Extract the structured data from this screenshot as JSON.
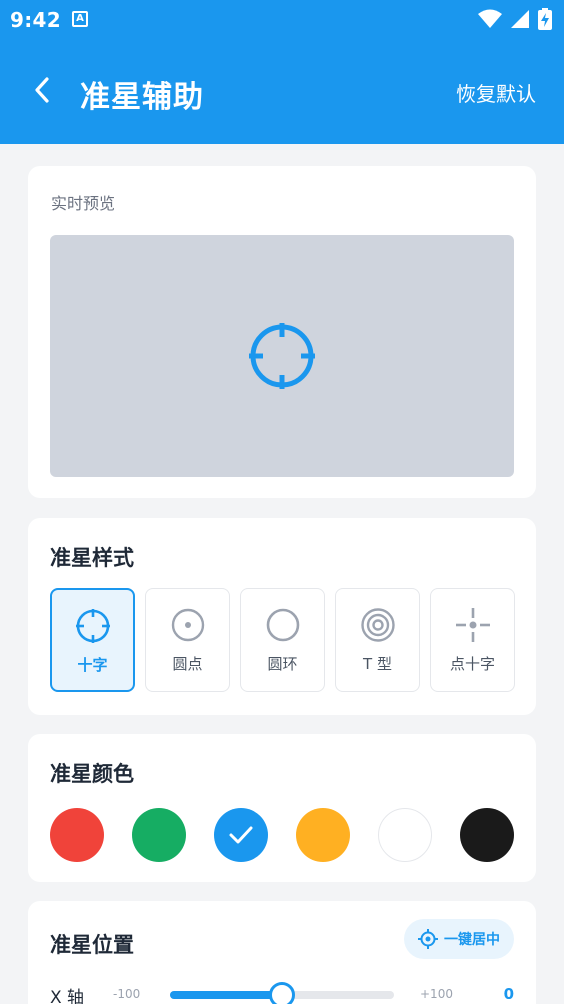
{
  "status": {
    "time": "9:42",
    "badge": "A"
  },
  "header": {
    "title": "准星辅助",
    "reset_label": "恢复默认"
  },
  "preview": {
    "label": "实时预览"
  },
  "style_section": {
    "title": "准星样式",
    "options": [
      {
        "label": "十字",
        "icon": "crosshair-icon",
        "selected": true
      },
      {
        "label": "圆点",
        "icon": "dot-icon",
        "selected": false
      },
      {
        "label": "圆环",
        "icon": "ring-icon",
        "selected": false
      },
      {
        "label": "T 型",
        "icon": "target-icon",
        "selected": false
      },
      {
        "label": "点十字",
        "icon": "dot-cross-icon",
        "selected": false
      }
    ]
  },
  "color_section": {
    "title": "准星颜色",
    "colors": [
      {
        "name": "red",
        "hex": "#f0433a"
      },
      {
        "name": "green",
        "hex": "#16ad63"
      },
      {
        "name": "blue",
        "hex": "#1a97ee",
        "selected": true
      },
      {
        "name": "amber",
        "hex": "#ffb022"
      },
      {
        "name": "white",
        "hex": "#ffffff"
      },
      {
        "name": "black",
        "hex": "#1a1a1a"
      }
    ]
  },
  "position_section": {
    "title": "准星位置",
    "center_button_label": "一键居中",
    "x_axis": {
      "label": "X 轴",
      "min_label": "-100",
      "max_label": "+100",
      "value": "0",
      "min": -100,
      "max": 100,
      "current": 0
    }
  },
  "theme": {
    "accent": "#1a97ee"
  }
}
